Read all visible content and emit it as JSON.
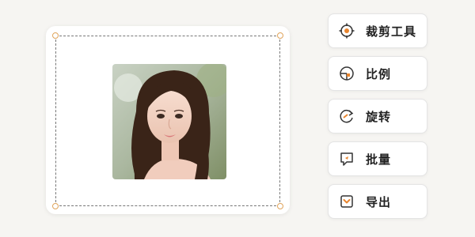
{
  "canvas": {
    "image_alt": "portrait photo"
  },
  "tools": [
    {
      "label": "裁剪工具",
      "icon": "crosshair-icon"
    },
    {
      "label": "比例",
      "icon": "ratio-icon"
    },
    {
      "label": "旋转",
      "icon": "rotate-icon"
    },
    {
      "label": "批量",
      "icon": "batch-icon"
    },
    {
      "label": "导出",
      "icon": "export-icon"
    }
  ],
  "colors": {
    "accent": "#e8852e",
    "handle": "#e0a45b",
    "background": "#f6f5f2"
  }
}
